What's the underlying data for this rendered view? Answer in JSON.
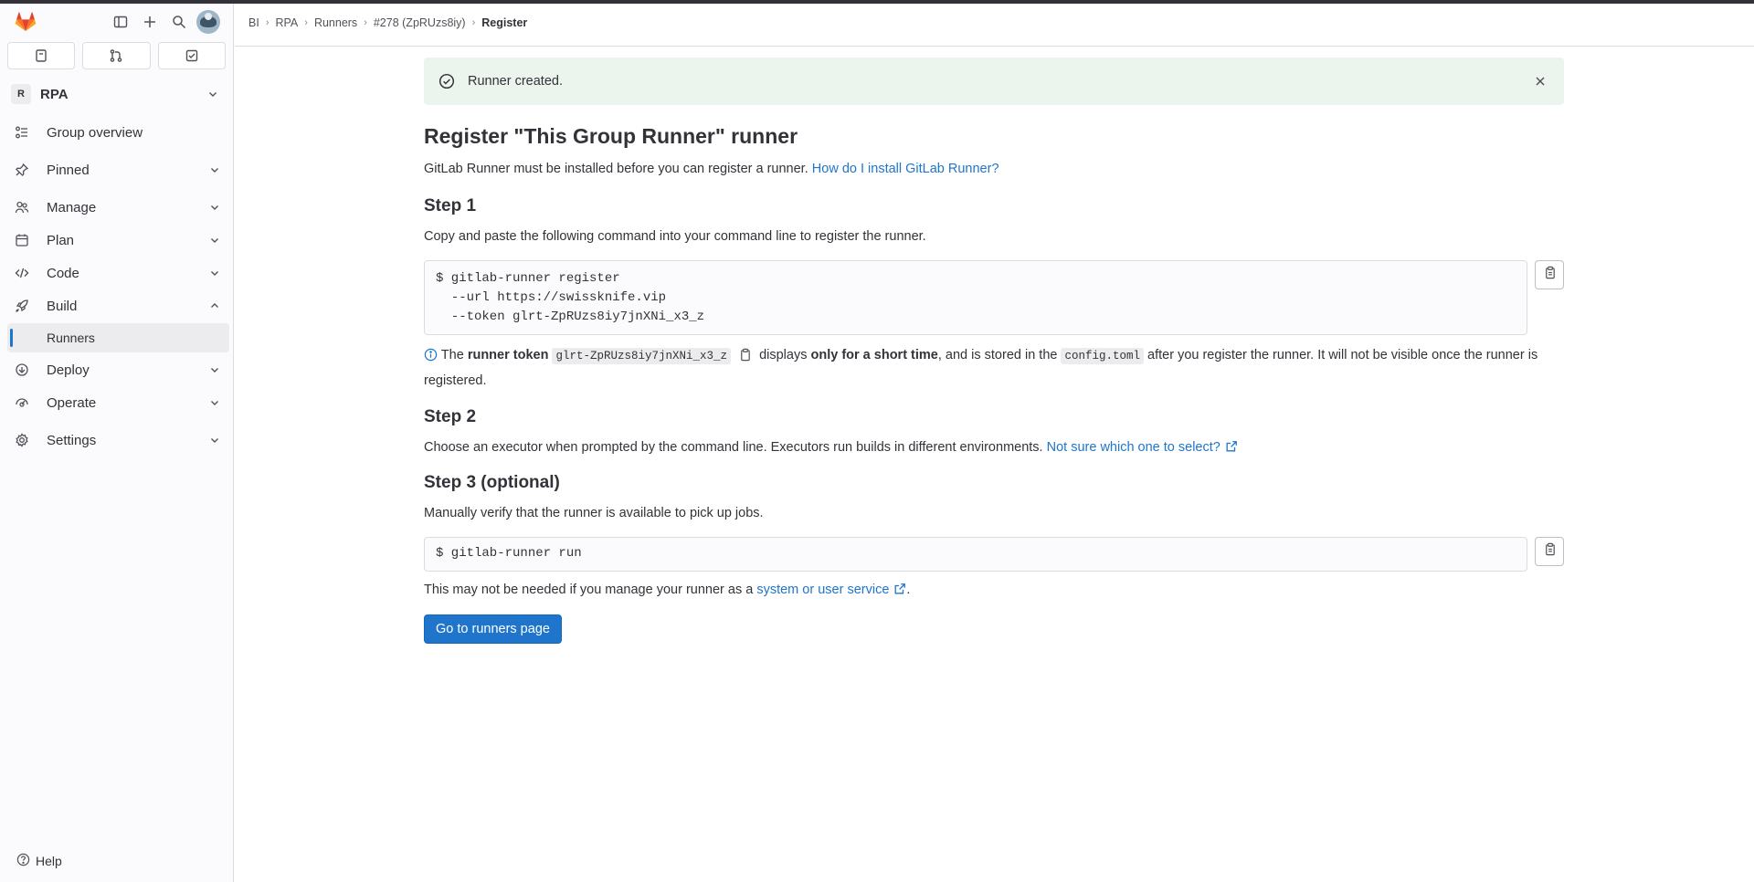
{
  "sidebar": {
    "context": {
      "avatar_letter": "R",
      "name": "RPA"
    },
    "items": [
      {
        "label": "Group overview",
        "icon": "group-icon"
      },
      {
        "label": "Pinned",
        "icon": "pin-icon"
      },
      {
        "label": "Manage",
        "icon": "users-icon"
      },
      {
        "label": "Plan",
        "icon": "calendar-icon"
      },
      {
        "label": "Code",
        "icon": "code-icon"
      },
      {
        "label": "Build",
        "icon": "rocket-icon"
      },
      {
        "label": "Runners",
        "icon": ""
      },
      {
        "label": "Deploy",
        "icon": "deploy-icon"
      },
      {
        "label": "Operate",
        "icon": "operate-icon"
      },
      {
        "label": "Settings",
        "icon": "settings-icon"
      }
    ],
    "help_label": "Help"
  },
  "breadcrumb": [
    "BI",
    "RPA",
    "Runners",
    "#278 (ZpRUzs8iy)",
    "Register"
  ],
  "alert": {
    "message": "Runner created."
  },
  "page": {
    "title": "Register \"This Group Runner\" runner",
    "intro_text": "GitLab Runner must be installed before you can register a runner.",
    "intro_link": "How do I install GitLab Runner?",
    "step1": {
      "heading": "Step 1",
      "desc": "Copy and paste the following command into your command line to register the runner.",
      "command": "$ gitlab-runner register\n  --url https://swissknife.vip\n  --token glrt-ZpRUzs8iy7jnXNi_x3_z",
      "note_the": "The",
      "note_token_label": "runner token",
      "token": "glrt-ZpRUzs8iy7jnXNi_x3_z",
      "note_displays": "displays",
      "note_short": "only for a short time",
      "note_stored": ", and is stored in the",
      "config_file": "config.toml",
      "note_after": "after you register the runner. It will not be visible once the runner is registered."
    },
    "step2": {
      "heading": "Step 2",
      "desc": "Choose an executor when prompted by the command line. Executors run builds in different environments.",
      "link": "Not sure which one to select?"
    },
    "step3": {
      "heading": "Step 3 (optional)",
      "desc": "Manually verify that the runner is available to pick up jobs.",
      "command": "$ gitlab-runner run",
      "note_text": "This may not be needed if you manage your runner as a",
      "note_link": "system or user service",
      "note_end": "."
    },
    "button_label": "Go to runners page"
  }
}
